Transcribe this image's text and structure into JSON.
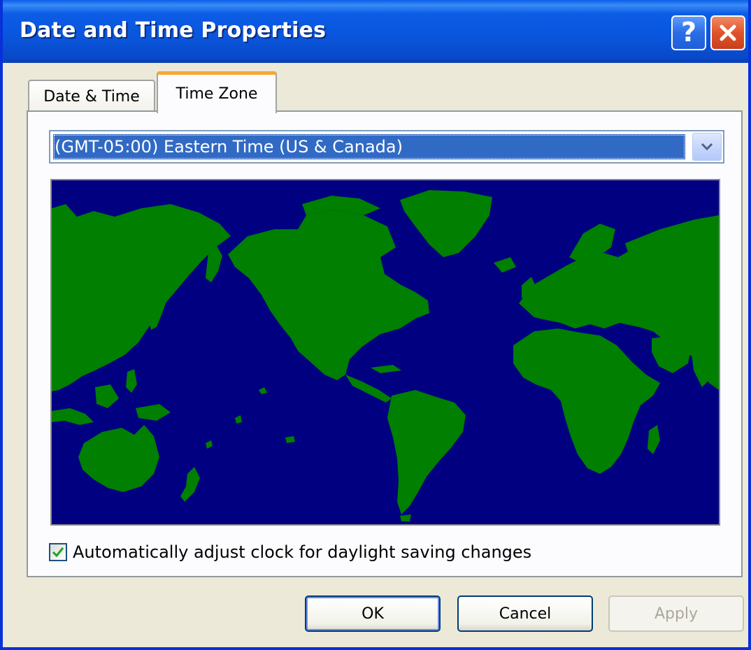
{
  "window": {
    "title": "Date and Time Properties",
    "help_label": "?"
  },
  "tabs": [
    {
      "label": "Date & Time",
      "selected": false
    },
    {
      "label": "Time Zone",
      "selected": true
    }
  ],
  "timezone": {
    "selected": "(GMT-05:00) Eastern Time (US & Canada)"
  },
  "map": {
    "ocean_color": "#000080",
    "land_color": "#007f00"
  },
  "daylight": {
    "label": "Automatically adjust clock for daylight saving changes",
    "checked": true
  },
  "buttons": {
    "ok": "OK",
    "cancel": "Cancel",
    "apply": "Apply",
    "apply_enabled": false
  },
  "icons": {
    "help": "help-icon",
    "close": "close-icon",
    "dropdown": "chevron-down-icon",
    "check": "checkmark-icon"
  }
}
